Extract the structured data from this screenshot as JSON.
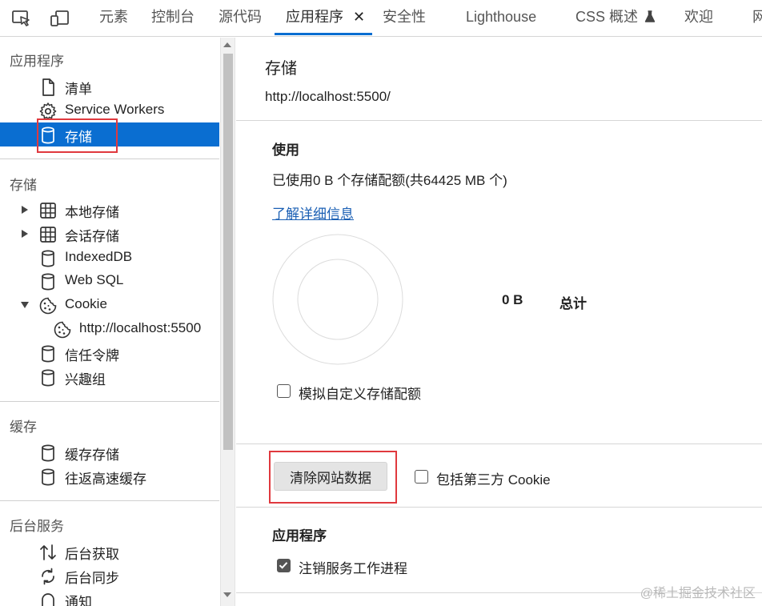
{
  "tabs": [
    {
      "label": "元素"
    },
    {
      "label": "控制台"
    },
    {
      "label": "源代码"
    },
    {
      "label": "应用程序"
    },
    {
      "label": "安全性"
    },
    {
      "label": "Lighthouse"
    },
    {
      "label": "CSS 概述"
    },
    {
      "label": "欢迎"
    },
    {
      "label": "网"
    }
  ],
  "sidebar": {
    "app_section": "应用程序",
    "app_items": [
      {
        "label": "清单",
        "icon": "document-icon"
      },
      {
        "label": "Service Workers",
        "icon": "gear-icon"
      },
      {
        "label": "存储",
        "icon": "database-icon"
      }
    ],
    "storage_section": "存储",
    "storage_items": [
      {
        "label": "本地存储",
        "icon": "grid-icon"
      },
      {
        "label": "会话存储",
        "icon": "grid-icon"
      },
      {
        "label": "IndexedDB",
        "icon": "database-icon"
      },
      {
        "label": "Web SQL",
        "icon": "database-icon"
      },
      {
        "label": "Cookie",
        "icon": "cookie-icon"
      },
      {
        "label": "http://localhost:5500",
        "icon": "cookie-icon"
      },
      {
        "label": "信任令牌",
        "icon": "database-icon"
      },
      {
        "label": "兴趣组",
        "icon": "database-icon"
      }
    ],
    "cache_section": "缓存",
    "cache_items": [
      {
        "label": "缓存存储",
        "icon": "database-icon"
      },
      {
        "label": "往返高速缓存",
        "icon": "database-icon"
      }
    ],
    "bg_section": "后台服务",
    "bg_items": [
      {
        "label": "后台获取",
        "icon": "arrows-up-down-icon"
      },
      {
        "label": "后台同步",
        "icon": "sync-icon"
      },
      {
        "label": "通知",
        "icon": "bell-icon"
      }
    ]
  },
  "main": {
    "title": "存储",
    "origin": "http://localhost:5500/",
    "usage_heading": "使用",
    "usage_text": "已使用0 B 个存储配额(共64425 MB 个)",
    "learn_more": "了解详细信息",
    "total_value": "0 B",
    "total_label": "总计",
    "simulate_quota_label": "模拟自定义存储配额",
    "simulate_quota_checked": false,
    "clear_button": "清除网站数据",
    "include_third_party_label": "包括第三方 Cookie",
    "include_third_party_checked": false,
    "app_heading": "应用程序",
    "unregister_label": "注销服务工作进程",
    "unregister_checked": true
  },
  "watermark": "@稀土掘金技术社区",
  "colors": {
    "accent": "#0a6ed1",
    "highlight_box": "#e0393e"
  }
}
